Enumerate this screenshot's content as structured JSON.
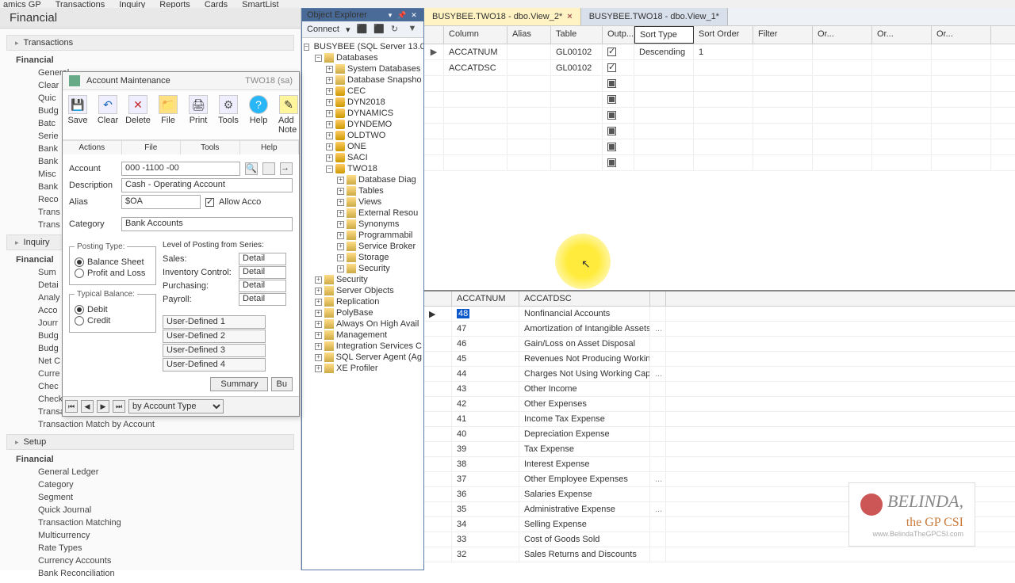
{
  "menu": [
    "amics GP",
    "Transactions",
    "Inquiry",
    "Reports",
    "Cards",
    "SmartList"
  ],
  "nav": {
    "title": "Financial",
    "groups": [
      {
        "label": "Transactions",
        "expand": "Financial",
        "items": [
          "General",
          "Clear",
          "Quic",
          "Budg",
          "Batc",
          "Serie",
          "Bank",
          "Bank",
          "Misc",
          "Bank",
          "Reco",
          "Trans",
          "Trans"
        ]
      },
      {
        "label": "Inquiry",
        "expand": "Financial",
        "items": [
          "Sum",
          "Detai",
          "Analy",
          "Acco",
          "Jourr",
          "Budg",
          "Budg",
          "Net C",
          "Curre",
          "Chec",
          "Checkbook Balance",
          "Transaction Match by Link Number",
          "Transaction Match by Account"
        ]
      },
      {
        "label": "Setup",
        "expand": "Financial",
        "items": [
          "General Ledger",
          "Category",
          "Segment",
          "Quick Journal",
          "Transaction Matching",
          "Multicurrency",
          "Rate Types",
          "Currency Accounts",
          "Bank Reconciliation"
        ]
      }
    ]
  },
  "dialog": {
    "title": "Account Maintenance",
    "context": "TWO18 (sa)",
    "buttons": [
      "Save",
      "Clear",
      "Delete",
      "File",
      "Print",
      "Tools",
      "Help",
      "Add Note"
    ],
    "sections": [
      "Actions",
      "File",
      "Tools",
      "Help"
    ],
    "account_lbl": "Account",
    "account": "000 -1100 -00",
    "desc_lbl": "Description",
    "desc": "Cash - Operating Account",
    "alias_lbl": "Alias",
    "alias": "$OA",
    "allow": "Allow Acco",
    "cat_lbl": "Category",
    "cat": "Bank Accounts",
    "posting_lbl": "Posting Type:",
    "pt1": "Balance Sheet",
    "pt2": "Profit and Loss",
    "bal_lbl": "Typical Balance:",
    "b1": "Debit",
    "b2": "Credit",
    "level_lbl": "Level of Posting from Series:",
    "levels": [
      [
        "Sales:",
        "Detail"
      ],
      [
        "Inventory Control:",
        "Detail"
      ],
      [
        "Purchasing:",
        "Detail"
      ],
      [
        "Payroll:",
        "Detail"
      ]
    ],
    "ud": [
      "User-Defined 1",
      "User-Defined 2",
      "User-Defined 3",
      "User-Defined 4"
    ],
    "summary": "Summary",
    "bu": "Bu",
    "byacct": "by Account Type"
  },
  "objexp": {
    "title": "Object Explorer",
    "connect": "Connect",
    "root": "BUSYBEE (SQL Server 13.0",
    "databases": "Databases",
    "sysdb": "System Databases",
    "snap": "Database Snapsho",
    "dbs": [
      "CEC",
      "DYN2018",
      "DYNAMICS",
      "DYNDEMO",
      "OLDTWO",
      "ONE",
      "SACI",
      "TWO18"
    ],
    "two18": [
      "Database Diag",
      "Tables",
      "Views",
      "External Resou",
      "Synonyms",
      "Programmabil",
      "Service Broker",
      "Storage",
      "Security"
    ],
    "after": [
      "Security",
      "Server Objects",
      "Replication",
      "PolyBase",
      "Always On High Avail",
      "Management",
      "Integration Services C",
      "SQL Server Agent (Ag",
      "XE Profiler"
    ]
  },
  "designer": {
    "tab1": "BUSYBEE.TWO18 - dbo.View_2*",
    "tab2": "BUSYBEE.TWO18 - dbo.View_1*",
    "cols": [
      "Column",
      "Alias",
      "Table",
      "Outp...",
      "Sort Type",
      "Sort Order",
      "Filter",
      "Or...",
      "Or...",
      "Or..."
    ],
    "rows": [
      {
        "col": "ACCATNUM",
        "tbl": "GL00102",
        "out": "on",
        "st": "Descending",
        "so": "1"
      },
      {
        "col": "ACCATDSC",
        "tbl": "GL00102",
        "out": "on"
      }
    ]
  },
  "results": {
    "h1": "ACCATNUM",
    "h2": "ACCATDSC",
    "rows": [
      [
        "48",
        "Nonfinancial Accounts",
        ""
      ],
      [
        "47",
        "Amortization of Intangible Assets",
        "..."
      ],
      [
        "46",
        "Gain/Loss on Asset Disposal",
        ""
      ],
      [
        "45",
        "Revenues Not Producing Working Ca...",
        ""
      ],
      [
        "44",
        "Charges Not Using Working Capital",
        "..."
      ],
      [
        "43",
        "Other Income",
        ""
      ],
      [
        "42",
        "Other Expenses",
        ""
      ],
      [
        "41",
        "Income Tax Expense",
        ""
      ],
      [
        "40",
        "Depreciation Expense",
        ""
      ],
      [
        "39",
        "Tax Expense",
        ""
      ],
      [
        "38",
        "Interest Expense",
        ""
      ],
      [
        "37",
        "Other Employee Expenses",
        "..."
      ],
      [
        "36",
        "Salaries Expense",
        ""
      ],
      [
        "35",
        "Administrative Expense",
        "..."
      ],
      [
        "34",
        "Selling Expense",
        ""
      ],
      [
        "33",
        "Cost of Goods Sold",
        ""
      ],
      [
        "32",
        "Sales Returns and Discounts",
        ""
      ]
    ]
  },
  "logo": {
    "l1": "BELINDA,",
    "l2": "the GP CSI",
    "l3": "www.BelindaTheGPCSI.com"
  },
  "chart_data": null
}
